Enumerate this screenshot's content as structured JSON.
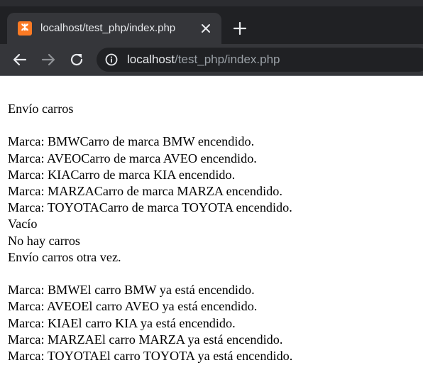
{
  "tab": {
    "title": "localhost/test_php/index.php",
    "favicon_icon": "xampp-icon",
    "favicon_glyph": "ⵣ",
    "favicon_color": "#fb7a24"
  },
  "toolbar": {
    "url_host": "localhost",
    "url_path": "/test_php/index.php"
  },
  "colors": {
    "tabstrip_bg": "#202124",
    "toolbar_bg": "#35363a",
    "omnibox_bg": "#202124",
    "text_primary": "#e8eaed",
    "text_secondary": "#9aa0a6"
  },
  "content": {
    "heading1": "Envío carros",
    "block1": [
      "Marca: BMWCarro de marca BMW encendido.",
      "Marca: AVEOCarro de marca AVEO encendido.",
      "Marca: KIACarro de marca KIA encendido.",
      "Marca: MARZACarro de marca MARZA encendido.",
      "Marca: TOYOTACarro de marca TOYOTA encendido."
    ],
    "empty": "Vacío",
    "no_cars": "No hay carros",
    "heading2": "Envío carros otra vez.",
    "block2": [
      "Marca: BMWEl carro BMW ya está encendido.",
      "Marca: AVEOEl carro AVEO ya está encendido.",
      "Marca: KIAEl carro KIA ya está encendido.",
      "Marca: MARZAEl carro MARZA ya está encendido.",
      "Marca: TOYOTAEl carro TOYOTA ya está encendido."
    ]
  }
}
